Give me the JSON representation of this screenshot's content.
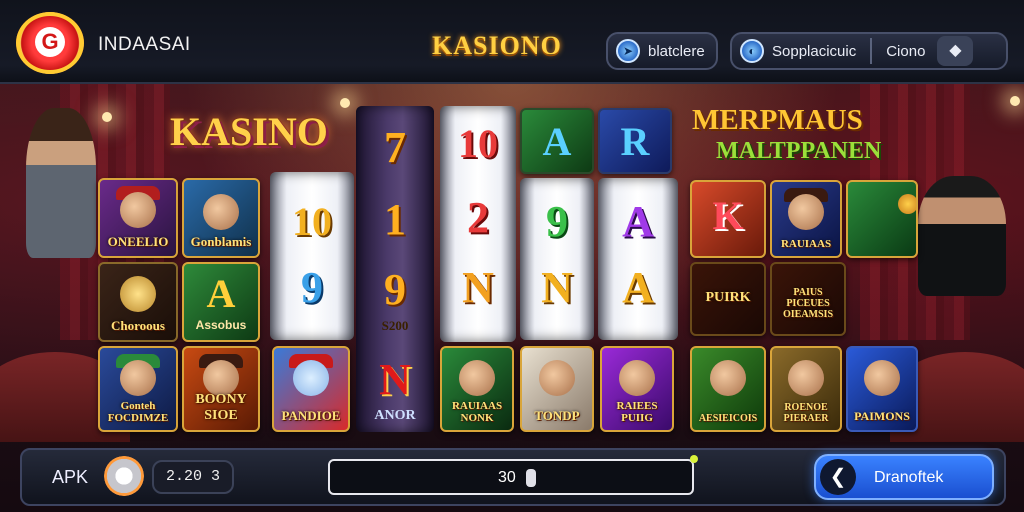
{
  "header": {
    "brand": "INDAASAI",
    "logo_letter": "G",
    "center_title": "KASIONO",
    "pill1": {
      "label": "blatclere",
      "icon": "arrow-icon"
    },
    "pill2": {
      "label": "Sopplacicuic",
      "secondary": "Ciono",
      "icon": "gauge-icon",
      "end_icon": "diamond-icon"
    }
  },
  "board": {
    "title_left": "KASINO",
    "title_right_line1": "MERPMAUS",
    "title_right_line2": "MALTPPANEN",
    "left_tiles": [
      {
        "label": "ONEELIO",
        "kind": "character"
      },
      {
        "label": "Gonblamis",
        "kind": "character"
      },
      {
        "label": "Choroous",
        "kind": "coin"
      },
      {
        "label": "Assobus",
        "symbol": "A",
        "kind": "letter"
      },
      {
        "label": "Gonteh FOCDIMZE",
        "kind": "character"
      },
      {
        "label": "BOONY SIOE",
        "kind": "character"
      },
      {
        "label": "PANDIOE",
        "kind": "character"
      }
    ],
    "reels": [
      {
        "symbols": [
          "10",
          "9"
        ]
      },
      {
        "symbols": [
          "7",
          "1",
          "9",
          "S200"
        ]
      },
      {
        "symbols": [
          "10",
          "2",
          "N"
        ]
      },
      {
        "symbols": [
          "9",
          "N"
        ]
      },
      {
        "symbols": [
          "A",
          "A"
        ]
      }
    ],
    "top_row": [
      "A",
      "R"
    ],
    "reel_bottom": {
      "symbol": "N",
      "label": "ANOR"
    },
    "bottom_tiles": [
      {
        "label": "RAUIAAS NONK"
      },
      {
        "label": "TONDP"
      },
      {
        "label": "RAIEES PUIIG"
      }
    ],
    "right_tiles": [
      {
        "label": "K",
        "kind": "letter"
      },
      {
        "label": "RAUIAAS",
        "kind": "character"
      },
      {
        "label": "",
        "kind": "table"
      },
      {
        "label": "PUIRK",
        "kind": "badge"
      },
      {
        "label": "PAIUS PICEUES OIEAMSIS",
        "kind": "badge"
      },
      {
        "label": "AESIEICOIS",
        "kind": "character"
      },
      {
        "label": "ROENOE PIERAER",
        "kind": "character"
      },
      {
        "label": "PAIMONS",
        "kind": "character"
      }
    ]
  },
  "footer": {
    "apk_label": "APK",
    "credits": "2.20 3",
    "bet_value": "30",
    "action_label": "Dranoftek",
    "action_icon": "chevron-left-icon"
  },
  "colors": {
    "accent_gold": "#ffd042",
    "accent_blue": "#3a82ff",
    "felt_red": "#8b2a2a"
  }
}
